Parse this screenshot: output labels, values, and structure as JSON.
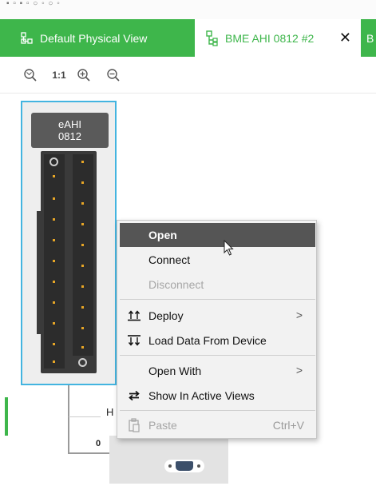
{
  "tabs": [
    {
      "label": "Default Physical View",
      "icon": "physical-view-icon"
    },
    {
      "label": "BME AHI 0812 #2",
      "icon": "module-tree-icon",
      "close_glyph": "✕"
    },
    {
      "label": "B"
    }
  ],
  "toolbar": {
    "zoom_fit_icon": "zoom-fit-icon",
    "actual_size_label": "1:1",
    "zoom_in_icon": "zoom-in-icon",
    "zoom_out_icon": "zoom-out-icon"
  },
  "module": {
    "line1": "eAHI",
    "line2": "0812"
  },
  "canvas": {
    "partial_h": "H",
    "partial_0": "0"
  },
  "context_menu": {
    "items": [
      {
        "label": "Open",
        "state": "highlighted"
      },
      {
        "label": "Connect"
      },
      {
        "label": "Disconnect",
        "state": "disabled"
      },
      {
        "label": "Deploy",
        "icon": "deploy-icon",
        "submenu_arrow": ">"
      },
      {
        "label": "Load Data From Device",
        "icon": "load-data-icon"
      },
      {
        "label": "Open With",
        "submenu_arrow": ">"
      },
      {
        "label": "Show In Active Views",
        "icon": "swap-arrows-icon"
      },
      {
        "label": "Paste",
        "icon": "paste-icon",
        "shortcut": "Ctrl+V",
        "state": "disabled"
      }
    ]
  },
  "colors": {
    "accent_green": "#3eb64b",
    "selection_blue": "#43b4e0",
    "menu_highlight": "#555555",
    "pin_orange": "#e7a626"
  }
}
